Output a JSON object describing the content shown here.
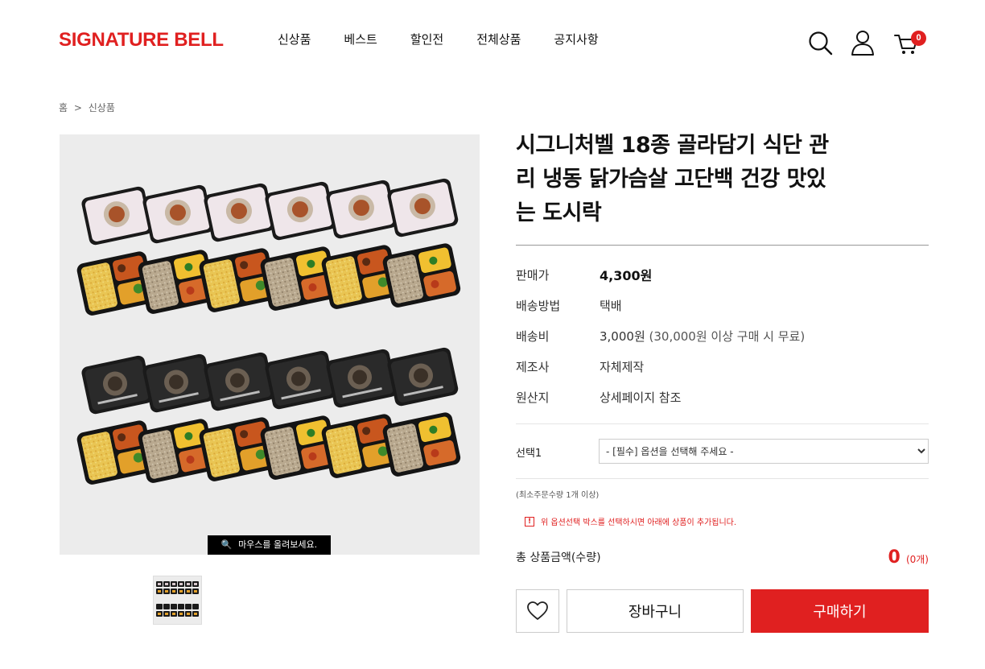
{
  "header": {
    "logo": "SIGNATURE BELL",
    "nav": [
      "신상품",
      "베스트",
      "할인전",
      "전체상품",
      "공지사항"
    ],
    "icons": [
      "search-icon",
      "user-icon",
      "cart-icon"
    ],
    "cart_count": "0",
    "brand_color": "#e02020"
  },
  "breadcrumb": {
    "home": "홈",
    "sep": ">",
    "current": "신상품"
  },
  "gallery": {
    "zoom_hint": "마우스를 올려보세요.",
    "zoom_icon": "magnifier-icon"
  },
  "product": {
    "title_lines": [
      "시그니처벨 18종 골라담기 식단 관",
      "리 냉동 닭가슴살 고단백 건강 맛있",
      "는 도시락"
    ],
    "info": [
      {
        "key": "판매가",
        "value": "4,300원"
      },
      {
        "key": "배송방법",
        "value": "택배"
      },
      {
        "key": "배송비",
        "value": "3,000원",
        "sub": " (30,000원 이상 구매 시 무료)"
      },
      {
        "key": "제조사",
        "value": "자체제작"
      },
      {
        "key": "원산지",
        "value": "상세페이지 참조"
      }
    ]
  },
  "options": {
    "label": "선택1",
    "selected": "- [필수] 옵션을 선택해 주세요 -"
  },
  "min_order": "(최소주문수량 1개 이상)",
  "notice": {
    "icon": "!",
    "text": "위 옵션선택 박스를 선택하시면 아래에 상품이 추가됩니다."
  },
  "total": {
    "label": "총 상품금액(수량)",
    "amount": "0",
    "qty": "(0개)"
  },
  "buttons": {
    "wish_icon": "heart-icon",
    "cart": "장바구니",
    "buy": "구매하기"
  }
}
